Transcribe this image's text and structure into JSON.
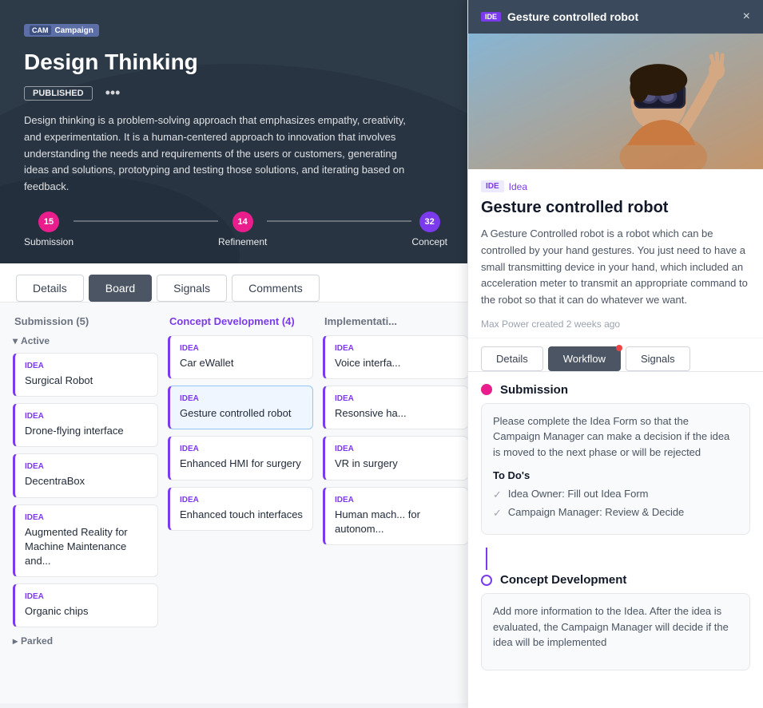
{
  "campaign": {
    "badge": "CAM",
    "badge_label": "Campaign",
    "title": "Design Thinking",
    "status": "PUBLISHED",
    "more_icon": "•••",
    "description": "Design thinking is a problem-solving approach that emphasizes empathy, creativity, and experimentation. It is a human-centered approach to innovation that involves understanding the needs and requirements of the users or customers, generating ideas and solutions, prototyping and testing those solutions, and iterating based on feedback.",
    "stages": [
      {
        "label": "Submission",
        "count": "15",
        "color": "pink"
      },
      {
        "label": "Refinement",
        "count": "14",
        "color": "pink"
      },
      {
        "label": "Concept",
        "count": "32",
        "color": "purple"
      }
    ]
  },
  "tabs": [
    {
      "label": "Details",
      "active": false
    },
    {
      "label": "Board",
      "active": true
    },
    {
      "label": "Signals",
      "active": false
    },
    {
      "label": "Comments",
      "active": false
    }
  ],
  "board": {
    "columns": [
      {
        "header": "Submission (5)",
        "color": "gray",
        "active_label": "Active",
        "cards": [
          {
            "label": "IDEA",
            "title": "Surgical Robot"
          },
          {
            "label": "IDEA",
            "title": "Drone-flying interface"
          },
          {
            "label": "IDEA",
            "title": "DecentraBox"
          },
          {
            "label": "IDEA",
            "title": "Augmented Reality for Machine Maintenance and..."
          },
          {
            "label": "IDEA",
            "title": "Organic chips"
          }
        ],
        "parked_label": "Parked"
      },
      {
        "header": "Concept Development (4)",
        "color": "purple",
        "cards": [
          {
            "label": "IDEA",
            "title": "Car eWallet"
          },
          {
            "label": "IDEA",
            "title": "Gesture controlled robot",
            "selected": true
          },
          {
            "label": "IDEA",
            "title": "Enhanced HMI for surgery"
          },
          {
            "label": "IDEA",
            "title": "Enhanced touch interfaces"
          }
        ]
      },
      {
        "header": "Implementati...",
        "color": "gray",
        "cards": [
          {
            "label": "IDEA",
            "title": "Voice interfa..."
          },
          {
            "label": "IDEA",
            "title": "Resonsive ha..."
          },
          {
            "label": "IDEA",
            "title": "VR in surgery"
          },
          {
            "label": "IDEA",
            "title": "Human mach... for autonom..."
          }
        ]
      }
    ]
  },
  "panel": {
    "header": {
      "ide_badge": "IDE",
      "title": "Gesture controlled robot",
      "close_icon": "×"
    },
    "idea_badge": "IDE",
    "idea_type": "Idea",
    "idea_title": "Gesture controlled robot",
    "idea_desc": "A Gesture Controlled robot is a robot which can be controlled by your hand gestures. You just need to have a small transmitting device in your hand, which included an acceleration meter to transmit an appropriate command to the robot so that it can do whatever we want.",
    "meta": "Max Power created 2 weeks ago",
    "tabs": [
      {
        "label": "Details",
        "active": false
      },
      {
        "label": "Workflow",
        "active": true,
        "dot": true
      },
      {
        "label": "Signals",
        "active": false
      }
    ],
    "workflow": {
      "stages": [
        {
          "name": "Submission",
          "dot_type": "filled",
          "box_desc": "Please complete the Idea Form so that the Campaign Manager can make a decision if the idea is moved to the next phase or will be rejected",
          "todos_label": "To Do's",
          "todos": [
            {
              "text": "Idea Owner: Fill out Idea Form",
              "done": false
            },
            {
              "text": "Campaign Manager: Review & Decide",
              "done": false
            }
          ]
        },
        {
          "name": "Concept Development",
          "dot_type": "outline",
          "box_desc": "Add more information to the Idea. After the idea is evaluated, the Campaign Manager will decide if the idea will be implemented"
        }
      ]
    }
  }
}
